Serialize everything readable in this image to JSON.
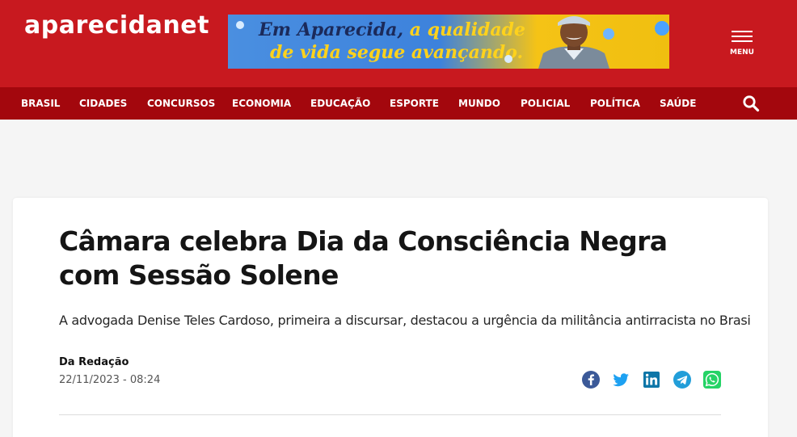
{
  "site": {
    "logo_text": "aparecidanet"
  },
  "banner": {
    "line1_part1": "Em Aparecida,",
    "line1_part2": " a qualidade",
    "line2": "de vida segue avançando."
  },
  "menu": {
    "label": "MENU"
  },
  "nav": {
    "items": [
      "BRASIL",
      "CIDADES",
      "CONCURSOS",
      "ECONOMIA",
      "EDUCAÇÃO",
      "ESPORTE",
      "MUNDO",
      "POLICIAL",
      "POLÍTICA",
      "SAÚDE"
    ]
  },
  "article": {
    "title": "Câmara celebra Dia da Consciência Negra com Sessão Solene",
    "subtitle": "A advogada Denise Teles Cardoso, primeira a discursar, destacou a urgência da militância antirracista no Brasi",
    "author": "Da Redação",
    "date": "22/11/2023 - 08:24"
  },
  "share": {
    "icons": [
      "facebook-icon",
      "twitter-icon",
      "linkedin-icon",
      "telegram-icon",
      "whatsapp-icon"
    ]
  },
  "colors": {
    "topbar": "#c8191f",
    "navbar": "#a3070d",
    "facebook": "#3b5998",
    "twitter": "#1da1f2",
    "linkedin": "#0e76a8",
    "telegram": "#229ed9",
    "whatsapp": "#25d366"
  }
}
